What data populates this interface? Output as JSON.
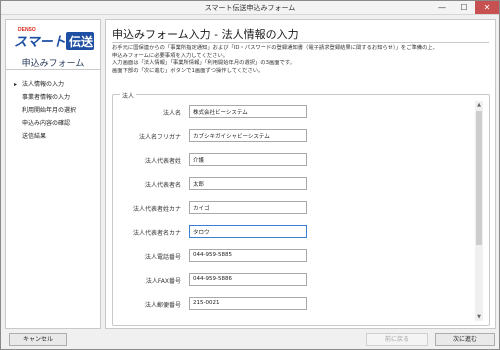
{
  "window": {
    "title": "スマート伝送申込みフォーム",
    "controls": {
      "minimize": "—",
      "maximize": "☐",
      "close": "✕"
    }
  },
  "sidebar": {
    "logo": {
      "brand": "DENSO",
      "text_main": "スマート",
      "text_box": "伝送"
    },
    "title": "申込みフォーム",
    "steps": [
      {
        "label": "法人情報の入力",
        "active": true
      },
      {
        "label": "事業者情報の入力",
        "active": false
      },
      {
        "label": "利用開始年月の選択",
        "active": false
      },
      {
        "label": "申込み内容の確認",
        "active": false
      },
      {
        "label": "送信結果",
        "active": false
      }
    ]
  },
  "main": {
    "title": "申込みフォーム入力 - 法人情報の入力",
    "instructions": [
      "お手元に国保連からの「事業所指定通知」および「ID・パスワードの登録通知書（電子請求登録結果に関するお知らせ）」をご準備の上、",
      "申込みフォームに必要事項を入力してください。",
      "入力画面は「法人情報」「事業所情報」「利用開始年月の選択」の3画面です。",
      "画面下部の「次に進む」ボタンで1画面ずつ操作してください。"
    ],
    "group_label": "法人",
    "fields": [
      {
        "label": "法人名",
        "value": "株式会社ビーシステム"
      },
      {
        "label": "法人名フリガナ",
        "value": "カブシキガイシャビーシステム"
      },
      {
        "label": "法人代表者姓",
        "value": "介護"
      },
      {
        "label": "法人代表者名",
        "value": "太郎"
      },
      {
        "label": "法人代表者姓カナ",
        "value": "カイゴ"
      },
      {
        "label": "法人代表者名カナ",
        "value": "タロウ",
        "focused": true
      },
      {
        "label": "法人電話番号",
        "value": "044-959-5885"
      },
      {
        "label": "法人FAX番号",
        "value": "044-959-5886"
      },
      {
        "label": "法人郵便番号",
        "value": "215-0021"
      }
    ]
  },
  "buttons": {
    "cancel": "キャンセル",
    "back": "前に戻る",
    "next": "次に進む"
  },
  "colors": {
    "logo_blue": "#1d4fa3",
    "logo_red": "#d6251c",
    "focus_border": "#3c7fd1"
  }
}
